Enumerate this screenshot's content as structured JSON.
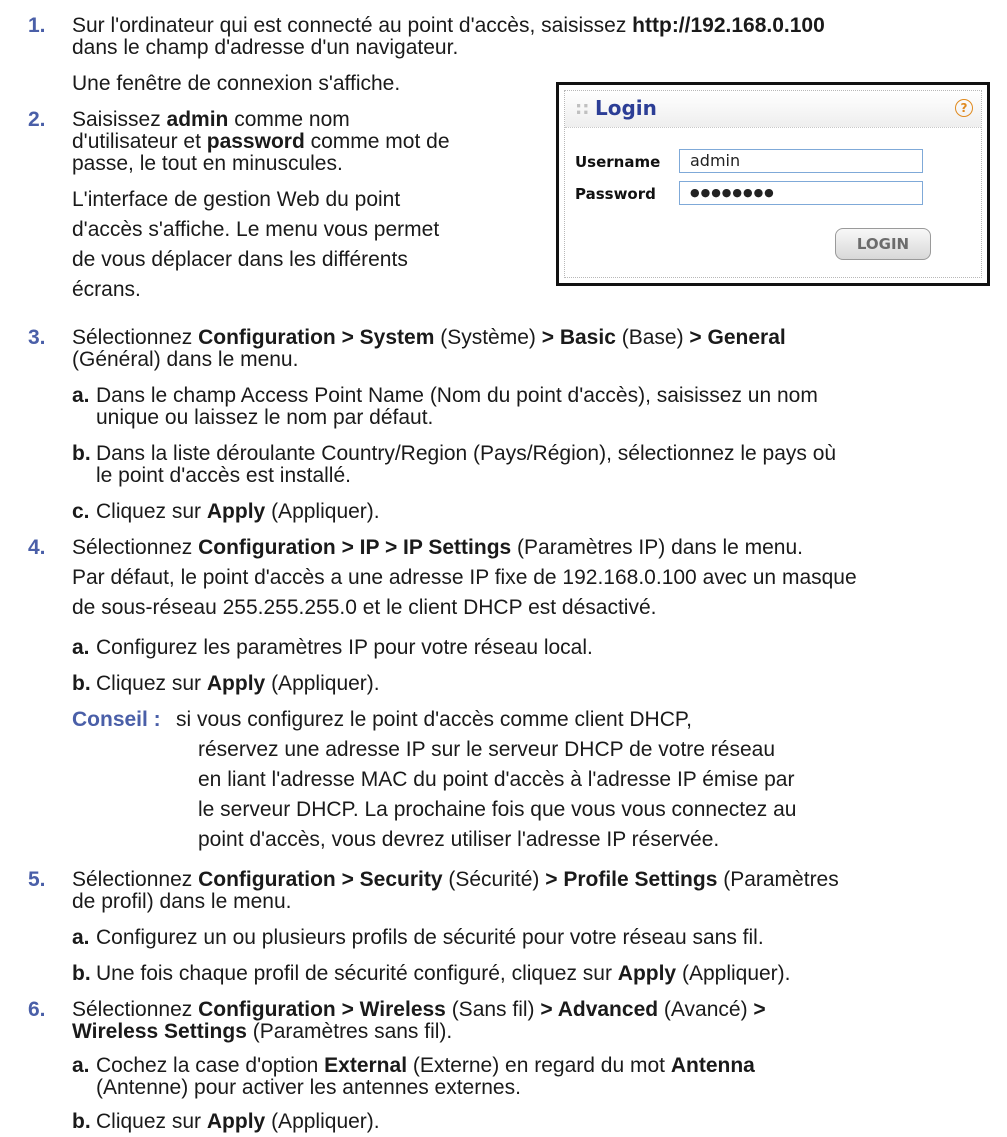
{
  "step1": {
    "num": "1.",
    "line1_pre": "Sur l'ordinateur qui est connecté au point d'accès, saisissez ",
    "line1_bold": "http://192.168.0.100",
    "line2": "dans le champ d'adresse d'un navigateur.",
    "note": "Une fenêtre de connexion s'affiche."
  },
  "step2": {
    "num": "2.",
    "l1_pre": "Saisissez ",
    "l1_bold": "admin",
    "l1_post": " comme nom",
    "l2_pre": "d'utilisateur et ",
    "l2_bold": "password",
    "l2_post": " comme mot de",
    "l3": "passe, le tout en minuscules.",
    "n1": "L'interface de gestion Web du point",
    "n2": "d'accès s'affiche. Le menu vous permet",
    "n3": "de vous déplacer dans les différents",
    "n4": "écrans."
  },
  "login": {
    "title": "Login",
    "help_icon": "help-icon",
    "username_label": "Username",
    "username_value": "admin",
    "password_label": "Password",
    "password_value": "●●●●●●●●",
    "button": "LOGIN"
  },
  "step3": {
    "num": "3.",
    "l1_a": "Sélectionnez ",
    "l1_b": "Configuration > System",
    "l1_c": " (Système) ",
    "l1_d": "> Basic",
    "l1_e": " (Base) ",
    "l1_f": "> General",
    "l2": "(Général) dans le menu.",
    "a_label": "a.",
    "a1": "Dans le champ Access Point Name (Nom du point d'accès), saisissez un nom",
    "a2": "unique ou laissez le nom par défaut.",
    "b_label": "b.",
    "b1": "Dans la liste déroulante Country/Region (Pays/Région), sélectionnez le pays où",
    "b2": "le point d'accès est installé.",
    "c_label": "c.",
    "c_pre": "Cliquez sur ",
    "c_bold": "Apply",
    "c_post": " (Appliquer)."
  },
  "step4": {
    "num": "4.",
    "l1_a": "Sélectionnez ",
    "l1_b": "Configuration > IP > IP Settings",
    "l1_c": " (Paramètres IP) dans le menu.",
    "p1": "Par défaut, le point d'accès a une adresse IP fixe de 192.168.0.100 avec un masque",
    "p2": "de sous-réseau 255.255.255.0 et le client DHCP est désactivé.",
    "a_label": "a.",
    "a1": "Configurez les paramètres IP pour votre réseau local.",
    "b_label": "b.",
    "b_pre": "Cliquez sur ",
    "b_bold": "Apply",
    "b_post": " (Appliquer).",
    "tip_label": "Conseil :",
    "tip1": "si vous configurez le point d'accès comme client DHCP,",
    "tip2": "réservez une adresse IP sur le serveur DHCP de votre réseau",
    "tip3": "en liant l'adresse MAC du point d'accès à l'adresse IP émise par",
    "tip4": "le serveur DHCP. La prochaine fois que vous vous connectez au",
    "tip5": "point d'accès, vous devrez utiliser l'adresse IP réservée."
  },
  "step5": {
    "num": "5.",
    "l1_a": "Sélectionnez ",
    "l1_b": "Configuration > Security",
    "l1_c": " (Sécurité) ",
    "l1_d": "> Profile Settings",
    "l1_e": " (Paramètres",
    "l2": "de profil) dans le menu.",
    "a_label": "a.",
    "a1": "Configurez un ou plusieurs profils de sécurité pour votre réseau sans fil.",
    "b_label": "b.",
    "b_pre": "Une fois chaque profil de sécurité configuré, cliquez sur ",
    "b_bold": "Apply",
    "b_post": " (Appliquer)."
  },
  "step6": {
    "num": "6.",
    "l1_a": "Sélectionnez ",
    "l1_b": "Configuration > Wireless",
    "l1_c": " (Sans fil) ",
    "l1_d": "> Advanced",
    "l1_e": " (Avancé) ",
    "l1_f": ">",
    "l2_a": "Wireless Settings",
    "l2_b": " (Paramètres sans fil).",
    "a_label": "a.",
    "a1_pre": "Cochez la case d'option ",
    "a1_bold1": "External",
    "a1_mid": " (Externe) en regard du mot ",
    "a1_bold2": "Antenna",
    "a2": "(Antenne) pour activer les antennes externes.",
    "b_label": "b.",
    "b_pre": "Cliquez sur ",
    "b_bold": "Apply",
    "b_post": " (Appliquer)."
  }
}
